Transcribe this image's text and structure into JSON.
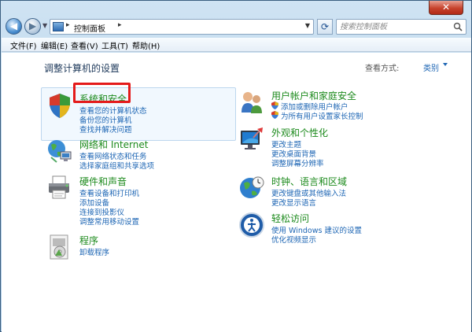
{
  "window": {
    "close_label": "✕"
  },
  "address": {
    "crumb": "控制面板",
    "search_placeholder": "搜索控制面板"
  },
  "menu": [
    {
      "label": "文件(F)"
    },
    {
      "label": "编辑(E)"
    },
    {
      "label": "查看(V)"
    },
    {
      "label": "工具(T)"
    },
    {
      "label": "帮助(H)"
    }
  ],
  "main": {
    "heading": "调整计算机的设置",
    "view_by_label": "查看方式:",
    "view_by_value": "类别"
  },
  "categories": {
    "system_security": {
      "title": "系统和安全",
      "links": [
        "查看您的计算机状态",
        "备份您的计算机",
        "查找并解决问题"
      ]
    },
    "network": {
      "title": "网络和 Internet",
      "links": [
        "查看网络状态和任务",
        "选择家庭组和共享选项"
      ]
    },
    "hardware": {
      "title": "硬件和声音",
      "links": [
        "查看设备和打印机",
        "添加设备",
        "连接到投影仪",
        "调整常用移动设置"
      ]
    },
    "programs": {
      "title": "程序",
      "links": [
        "卸载程序"
      ]
    },
    "users": {
      "title": "用户帐户和家庭安全",
      "links": [
        "添加或删除用户帐户",
        "为所有用户设置家长控制"
      ]
    },
    "appearance": {
      "title": "外观和个性化",
      "links": [
        "更改主题",
        "更改桌面背景",
        "调整屏幕分辨率"
      ]
    },
    "clock": {
      "title": "时钟、语言和区域",
      "links": [
        "更改键盘或其他输入法",
        "更改显示语言"
      ]
    },
    "ease": {
      "title": "轻松访问",
      "links": [
        "使用 Windows 建议的设置",
        "优化视频显示"
      ]
    }
  },
  "colors": {
    "link": "#1e66b4",
    "category_title": "#1c8a1c",
    "annotation": "#e41a1a"
  }
}
